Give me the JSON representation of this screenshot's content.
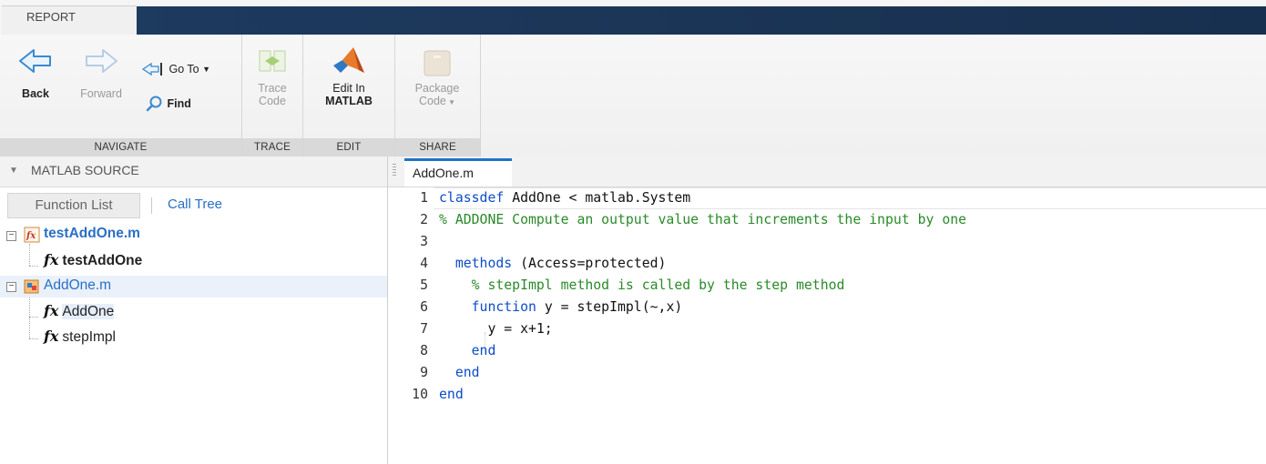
{
  "window": {
    "tab": "REPORT"
  },
  "ribbon": {
    "navigate": {
      "label": "NAVIGATE",
      "back": "Back",
      "forward": "Forward",
      "goto": "Go To",
      "find": "Find"
    },
    "trace": {
      "label": "TRACE",
      "trace_code_1": "Trace",
      "trace_code_2": "Code"
    },
    "edit": {
      "label": "EDIT",
      "edit_1": "Edit In",
      "edit_2": "MATLAB"
    },
    "share": {
      "label": "SHARE",
      "package_1": "Package",
      "package_2": "Code"
    }
  },
  "left_pane": {
    "header": "MATLAB SOURCE",
    "tabs": [
      "Function List",
      "Call Tree"
    ],
    "tree": [
      {
        "label": "testAddOne.m",
        "children": [
          "testAddOne"
        ]
      },
      {
        "label": "AddOne.m",
        "children": [
          "AddOne",
          "stepImpl"
        ]
      }
    ]
  },
  "editor": {
    "tab": "AddOne.m",
    "lines": [
      {
        "n": "1",
        "a": "classdef",
        "b": " AddOne < matlab.System",
        "c": ""
      },
      {
        "n": "2",
        "a": "",
        "b": "",
        "c": "% ADDONE Compute an output value that increments the input by one"
      },
      {
        "n": "3",
        "a": "",
        "b": "",
        "c": ""
      },
      {
        "n": "4",
        "a": "  methods",
        "b": " (Access=protected)",
        "c": ""
      },
      {
        "n": "5",
        "a": "",
        "b": "",
        "c": "    % stepImpl method is called by the step method"
      },
      {
        "n": "6",
        "a": "    function",
        "b": " y = stepImpl(~,x)",
        "c": ""
      },
      {
        "n": "7",
        "a": "",
        "b": "      y = x+1;",
        "c": ""
      },
      {
        "n": "8",
        "a": "    end",
        "b": "",
        "c": ""
      },
      {
        "n": "9",
        "a": "  end",
        "b": "",
        "c": ""
      },
      {
        "n": "10",
        "a": "end",
        "b": "",
        "c": ""
      }
    ]
  },
  "colors": {
    "keyword": "#0e4cc8",
    "comment": "#2a8a2a",
    "link": "#2a6fc4",
    "tab_accent": "#1f73c9"
  }
}
